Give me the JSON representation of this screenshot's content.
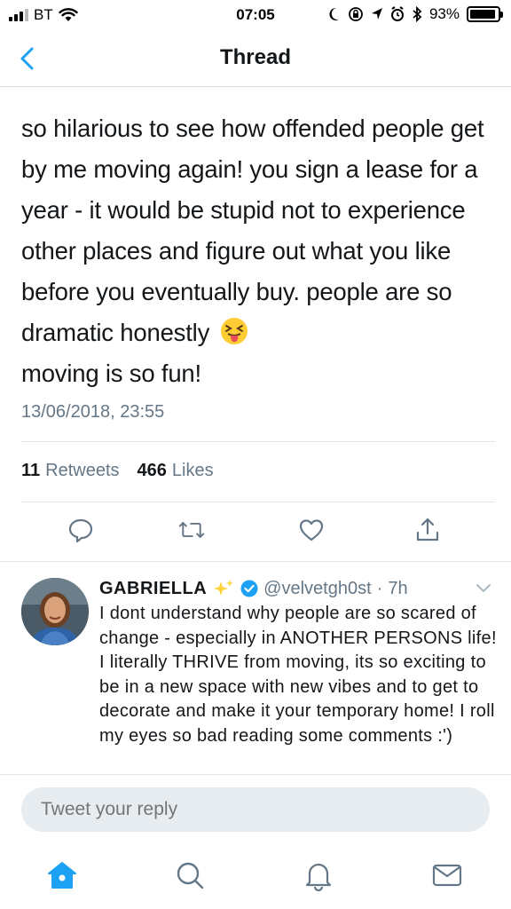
{
  "status_bar": {
    "carrier": "BT",
    "time": "07:05",
    "battery": "93%",
    "battery_level": 0.93
  },
  "nav": {
    "title": "Thread",
    "back_icon": "chevron-left-icon"
  },
  "tweet": {
    "text": "so hilarious to see how offended people get by me moving again! you sign a lease for a year - it would be stupid not to experience other places and figure out what you like before you eventually buy. people are so dramatic honestly",
    "text_end": "moving is so fun!",
    "emoji": "squinting-tongue-emoji",
    "timestamp": "13/06/2018, 23:55",
    "retweets_count": "11",
    "retweets_label": "Retweets",
    "likes_count": "466",
    "likes_label": "Likes"
  },
  "actions": [
    "reply-icon",
    "retweet-icon",
    "like-icon",
    "share-icon"
  ],
  "reply": {
    "name": "GABRIELLA",
    "handle": "@velvetgh0st",
    "separator": "·",
    "age": "7h",
    "text": "I dont understand why people are so scared of change - especially in ANOTHER PERSONS life! I literally THRIVE from moving, its so exciting to be in a new space with new vibes and to get to decorate and make it your temporary home! I roll my eyes so bad reading some comments :')"
  },
  "composer": {
    "placeholder": "Tweet your reply"
  },
  "tab_bar": [
    "home-icon",
    "search-icon",
    "notifications-icon",
    "messages-icon"
  ],
  "colors": {
    "accent": "#1da1f2",
    "text": "#14171a",
    "secondary": "#657786",
    "divider": "#e1e8ed"
  }
}
